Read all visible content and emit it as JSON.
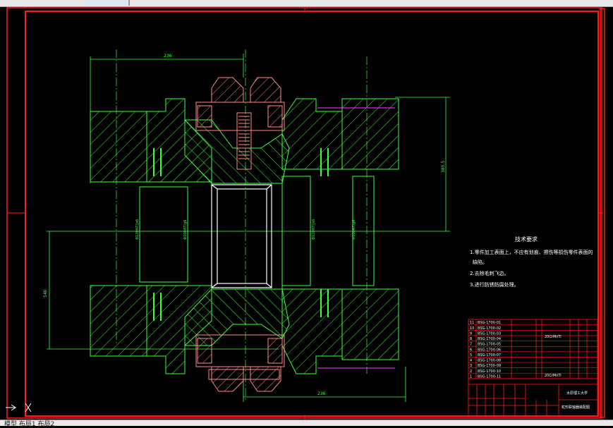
{
  "app": {
    "status_text": "模型 布局1 布局2"
  },
  "colors": {
    "frame": "#ff1a1a",
    "outline": "#3cff3c",
    "hatch": "#3cff3c",
    "part": "#ff8a8a",
    "white": "#ffffff",
    "center": "#ff40ff"
  },
  "drawing": {
    "dims": {
      "top_width": "236",
      "bottom_width": "236",
      "height_right": "385.5",
      "height_left": "540"
    },
    "bore_labels": [
      "Φ120H7/js6",
      "Φ100H7/g6",
      "Φ120H7/js6",
      "Φ100H7/g6"
    ],
    "tech_req": {
      "title": "技术要求",
      "items": [
        "1.零件加工表面上，不应有划痕、擦伤等损伤零件表面的",
        "缺陷。",
        "2.去除毛刺飞边。",
        "3.进行防锈防腐处理。"
      ]
    },
    "bom": [
      {
        "no": "11",
        "code": "BSG-1700-01"
      },
      {
        "no": "10",
        "code": "BSG-1700-02"
      },
      {
        "no": "9",
        "code": "BSG-1700-03"
      },
      {
        "no": "8",
        "code": "BSG-1700-04"
      },
      {
        "no": "7",
        "code": "BSG-1700-05"
      },
      {
        "no": "6",
        "code": "BSG-1700-06"
      },
      {
        "no": "5",
        "code": "BSG-1700-07"
      },
      {
        "no": "4",
        "code": "BSG-1700-08"
      },
      {
        "no": "3",
        "code": "BSG-1700-09"
      },
      {
        "no": "2",
        "code": "BSG-1700-10"
      },
      {
        "no": "1",
        "code": "BSG-1700-11"
      }
    ],
    "bom_materials": [
      "20CrMnTi",
      "20CrMnTi"
    ],
    "title_block": {
      "school": "太原理工大学",
      "drawing_name": "蛇形联轴器装配图"
    }
  }
}
